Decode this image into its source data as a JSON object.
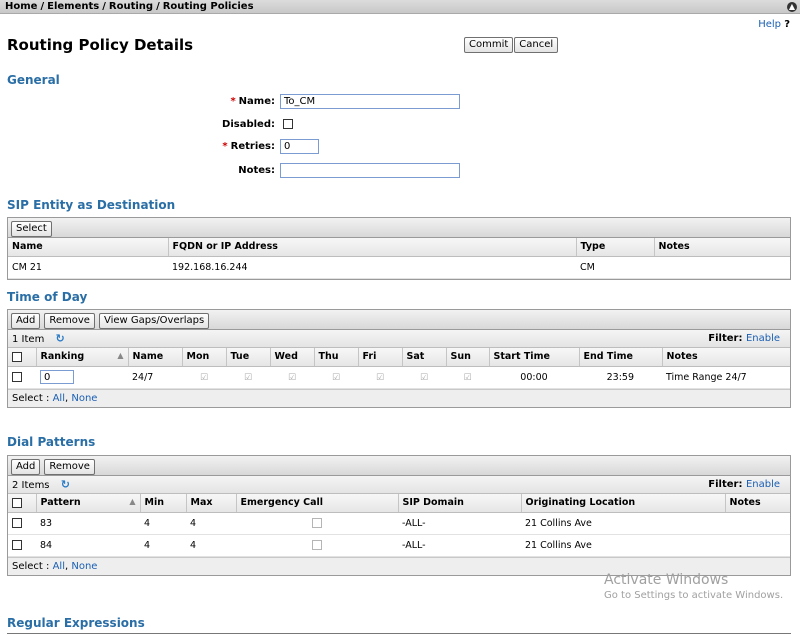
{
  "breadcrumb": [
    "Home",
    "Elements",
    "Routing",
    "Routing Policies"
  ],
  "help": {
    "label": "Help",
    "q": "?"
  },
  "page_title": "Routing Policy Details",
  "buttons": {
    "commit": "Commit",
    "cancel": "Cancel"
  },
  "general": {
    "title": "General",
    "name_label": "Name:",
    "name_value": "To_CM",
    "disabled_label": "Disabled:",
    "retries_label": "Retries:",
    "retries_value": "0",
    "notes_label": "Notes:",
    "notes_value": "",
    "required_mark": "*"
  },
  "sip_entity": {
    "title": "SIP Entity as Destination",
    "select_button": "Select",
    "columns": [
      "Name",
      "FQDN or IP Address",
      "Type",
      "Notes"
    ],
    "row": {
      "name": "CM 21",
      "fqdn": "192.168.16.244",
      "type": "CM",
      "notes": ""
    }
  },
  "time_of_day": {
    "title": "Time of Day",
    "add_button": "Add",
    "remove_button": "Remove",
    "gaps_button": "View Gaps/Overlaps",
    "count": "1 Item",
    "filter_label": "Filter:",
    "filter_link": "Enable",
    "columns": [
      "Ranking",
      "Name",
      "Mon",
      "Tue",
      "Wed",
      "Thu",
      "Fri",
      "Sat",
      "Sun",
      "Start Time",
      "End Time",
      "Notes"
    ],
    "row": {
      "ranking": "0",
      "name": "24/7",
      "start": "00:00",
      "end": "23:59",
      "notes": "Time Range 24/7"
    },
    "select_label": "Select :",
    "all_link": "All",
    "none_link": "None"
  },
  "dial_patterns": {
    "title": "Dial Patterns",
    "add_button": "Add",
    "remove_button": "Remove",
    "count": "2 Items",
    "filter_label": "Filter:",
    "filter_link": "Enable",
    "columns": [
      "Pattern",
      "Min",
      "Max",
      "Emergency Call",
      "SIP Domain",
      "Originating Location",
      "Notes"
    ],
    "rows": [
      {
        "pattern": "83",
        "min": "4",
        "max": "4",
        "domain": "-ALL-",
        "location": "21 Collins Ave",
        "notes": ""
      },
      {
        "pattern": "84",
        "min": "4",
        "max": "4",
        "domain": "-ALL-",
        "location": "21 Collins Ave",
        "notes": ""
      }
    ],
    "select_label": "Select :",
    "all_link": "All",
    "none_link": "None"
  },
  "regular_expressions": {
    "title": "Regular Expressions"
  },
  "watermark": {
    "line1": "Activate Windows",
    "line2": "Go to Settings to activate Windows."
  },
  "colors": {
    "section_title": "#2a6ea6",
    "link": "#1a5fb4",
    "required": "#cc0000"
  }
}
